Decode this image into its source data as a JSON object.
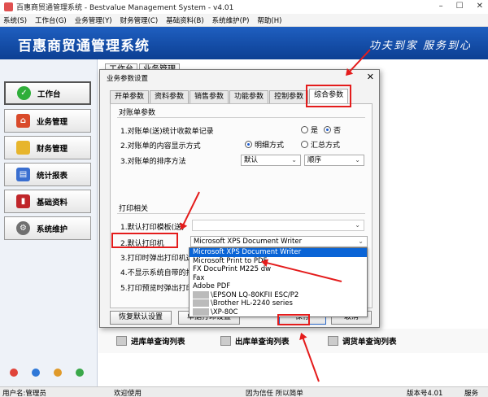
{
  "window": {
    "title": "百惠商贸通管理系统 - Bestvalue Management System - v4.01",
    "controls": [
      "–",
      "☐",
      "✕"
    ]
  },
  "menu": [
    "系统(S)",
    "工作台(G)",
    "业务管理(Y)",
    "财务管理(C)",
    "基础资料(B)",
    "系统维护(P)",
    "帮助(H)"
  ],
  "banner": {
    "logo": "百惠商贸通管理系统",
    "slogan": "功夫到家  服务到心"
  },
  "sidebar": {
    "items": [
      {
        "label": "工作台",
        "icon": "check-icon",
        "color": "#2fae3a"
      },
      {
        "label": "业务管理",
        "icon": "house-icon",
        "color": "#d94a2a"
      },
      {
        "label": "财务管理",
        "icon": "folder-icon",
        "color": "#e7b52c"
      },
      {
        "label": "统计报表",
        "icon": "chart-icon",
        "color": "#3a6fd0"
      },
      {
        "label": "基础资料",
        "icon": "book-icon",
        "color": "#c0262a"
      },
      {
        "label": "系统维护",
        "icon": "gear-icon",
        "color": "#707070"
      }
    ],
    "bottom_icon_colors": [
      "#e0443a",
      "#2f78d8",
      "#e09a2a",
      "#3aa84a"
    ]
  },
  "content": {
    "bg_tabs": [
      "工作台",
      "业务管理"
    ],
    "quick_links": [
      "进库单查询列表",
      "出库单查询列表",
      "调货单查询列表"
    ]
  },
  "status": {
    "user": "用户名:管理员",
    "welcome": "欢迎使用",
    "motto": "因为信任 所以简单",
    "version": "版本号4.01",
    "service": "服务"
  },
  "dialog": {
    "title": "业务参数设置",
    "tabs": [
      "开单参数",
      "资料参数",
      "销售参数",
      "功能参数",
      "控制参数",
      "综合参数"
    ],
    "active_tab": "综合参数",
    "group1": {
      "title": "对账单参数",
      "rows": [
        "1.对账单(送)统计收款单记录",
        "2.对账单的内容显示方式",
        "3.对账单的排序方法"
      ],
      "radio_yes": "是",
      "radio_no": "否",
      "radio_detail": "明细方式",
      "radio_summary": "汇总方式",
      "sort_field": "默认",
      "sort_order": "顺序"
    },
    "group2": {
      "title": "打印相关",
      "rows": [
        "1.默认打印模板(送)",
        "2.默认打印机",
        "3.打印时弹出打印机选",
        "4.不显示系统自带的打",
        "5.打印预览时弹出打印"
      ],
      "printer_value": "Microsoft XPS Document Writer"
    },
    "buttons": {
      "restore": "恢复默认设置",
      "printer_settings": "单据打印设置",
      "save": "保存",
      "cancel": "取消"
    }
  },
  "dropdown": {
    "options": [
      "Microsoft XPS Document Writer",
      "Microsoft Print to PDF",
      "FX DocuPrint M225 dw",
      "Fax",
      "Adobe PDF",
      "\\EPSON LQ-80KFII ESC/P2",
      "\\Brother HL-2240 series",
      "\\XP-80C"
    ],
    "selected": "Microsoft XPS Document Writer"
  },
  "accent_color": "#e41c1c",
  "brand_color": "#0c3f93"
}
